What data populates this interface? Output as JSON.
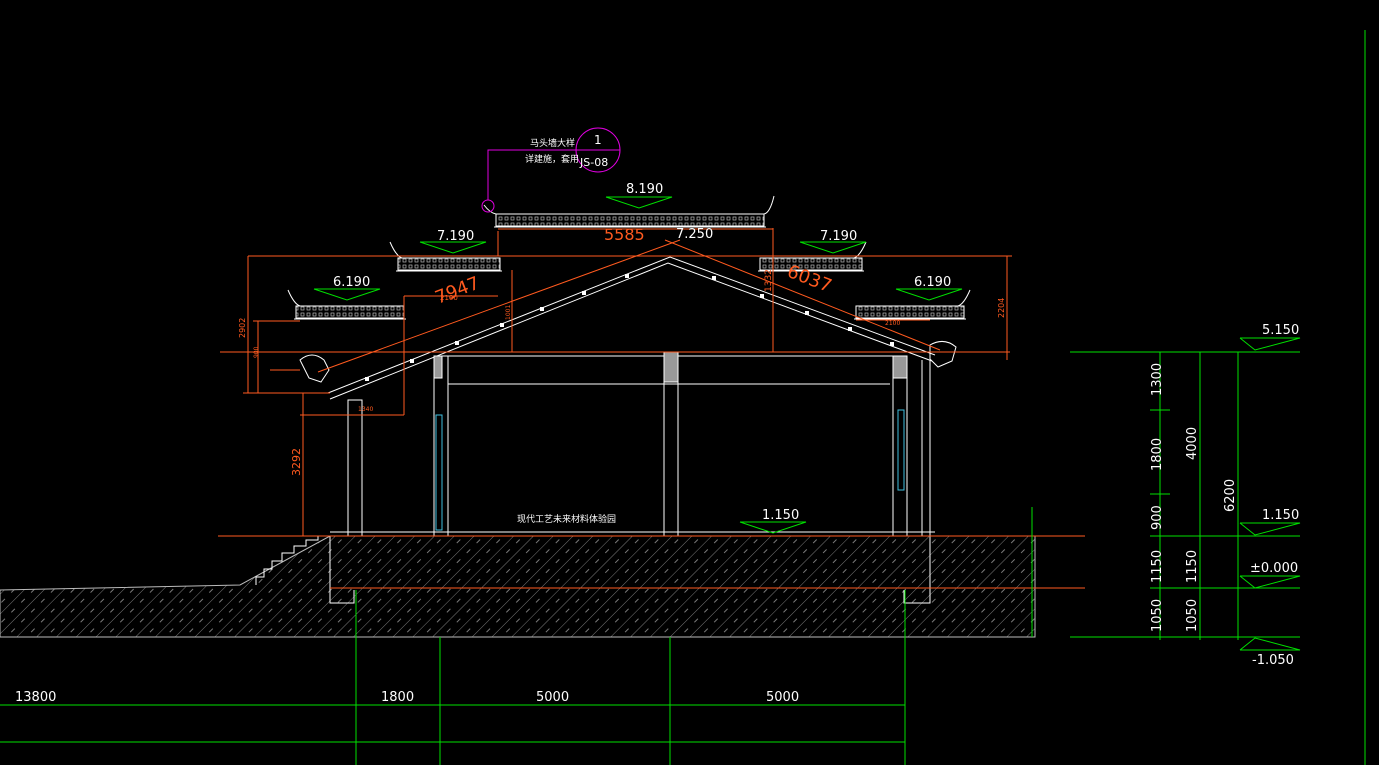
{
  "colors": {
    "background": "#000000",
    "building": "#ffffff",
    "dimension": "#ff5a1f",
    "grid": "#00e000",
    "callout": "#e000e0",
    "glass": "#40c0e0",
    "hatch": "#8a8a8a",
    "text": "#ffffff"
  },
  "callout": {
    "line1": "马头墙大样",
    "line2": "详建施，套用",
    "number": "1",
    "sheet": "JS-08"
  },
  "elevation_marks": {
    "ridge": "8.190",
    "ridge_inner": "7.250",
    "left_mid": "7.190",
    "right_mid": "7.190",
    "left_low": "6.190",
    "right_low": "6.190",
    "floor": "1.150",
    "right_top": "5.150",
    "right_floor": "1.150",
    "right_ground": "±0.000",
    "right_bottom": "-1.050"
  },
  "roof_dims": {
    "left_slope": "7947",
    "right_slope": "6037",
    "ridge_span": "5585",
    "left_height": "2902",
    "right_height": "2204",
    "left_sub": "900",
    "left_lower": "3292",
    "left_width": "2100",
    "right_width": "2100",
    "left_eave": "1340",
    "center": "1001",
    "right_center": "1332"
  },
  "room_label": "现代工艺未来材料体验园",
  "vertical_dims": {
    "chain_a": [
      "1300",
      "1800",
      "900",
      "1150",
      "1050"
    ],
    "chain_b": [
      "4000",
      "1150",
      "1050"
    ],
    "overall": "6200"
  },
  "horizontal_dims": [
    "13800",
    "1800",
    "5000",
    "5000"
  ]
}
